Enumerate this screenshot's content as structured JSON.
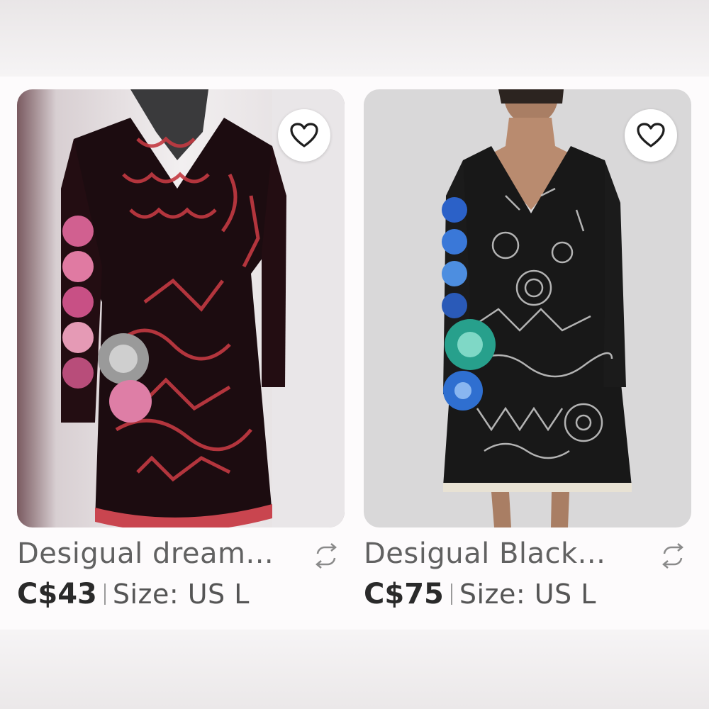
{
  "listings": [
    {
      "title": "Desigual dream...",
      "price": "C$43",
      "size": "Size: US L",
      "image": "red-black-patterned-dress-on-mannequin",
      "like_icon": "heart-icon",
      "share_icon": "repost-icon"
    },
    {
      "title": "Desigual Black...",
      "price": "C$75",
      "size": "Size: US L",
      "image": "black-white-doodle-dress-on-model",
      "like_icon": "heart-icon",
      "share_icon": "repost-icon"
    }
  ],
  "colors": {
    "title_text": "#616161",
    "price_text": "#2a2a2a",
    "background": "#f6f4f5"
  }
}
